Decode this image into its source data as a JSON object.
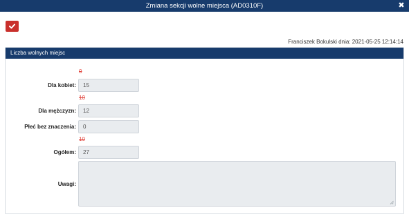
{
  "window": {
    "title": "Zmiana sekcji wolne miejsca (AD0310F)",
    "close_glyph": "✖"
  },
  "toolbar": {
    "confirm_icon": "check-icon",
    "confirm_color": "#c9302c"
  },
  "meta": {
    "author_line": "Franciszek Bokulski dnia: 2021-05-25 12:14:14"
  },
  "panel": {
    "title": "Liczba wolnych miejsc",
    "header_color": "#173b6c"
  },
  "form": {
    "women": {
      "label": "Dla kobiet:",
      "old_value": "0",
      "value": "15"
    },
    "men": {
      "label": "Dla mężczyzn:",
      "old_value": "10",
      "value": "12"
    },
    "any": {
      "label": "Płeć bez znaczenia:",
      "value": "0"
    },
    "total": {
      "label": "Ogółem:",
      "old_value": "10",
      "value": "27"
    },
    "notes": {
      "label": "Uwagi:",
      "value": ""
    }
  }
}
